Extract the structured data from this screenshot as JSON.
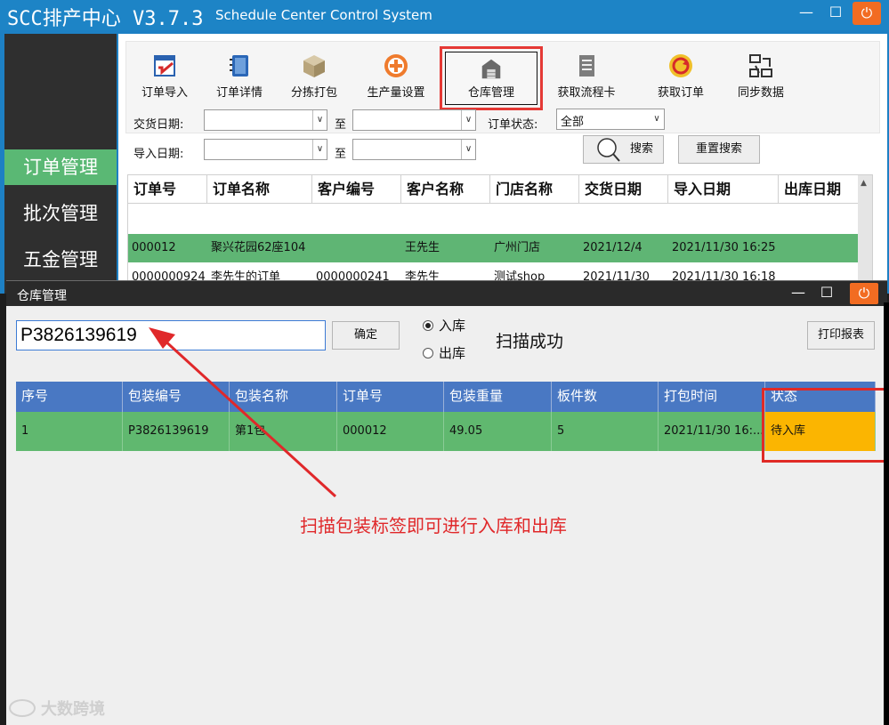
{
  "main": {
    "title": "SCC排产中心 V3.7.3",
    "subtitle": "Schedule Center Control System",
    "window_buttons": {
      "min": "—",
      "max": "☐",
      "close": "⏻"
    }
  },
  "nav": {
    "items": [
      {
        "label": "订单管理",
        "active": true
      },
      {
        "label": "批次管理",
        "active": false
      },
      {
        "label": "五金管理",
        "active": false
      }
    ]
  },
  "toolbar": {
    "items": [
      {
        "label": "订单导入",
        "icon": "order-import-icon"
      },
      {
        "label": "订单详情",
        "icon": "notebook-icon"
      },
      {
        "label": "分拣打包",
        "icon": "package-box-icon"
      },
      {
        "label": "生产量设置",
        "icon": "plus-circle-icon"
      },
      {
        "label": "仓库管理",
        "icon": "warehouse-icon"
      },
      {
        "label": "获取流程卡",
        "icon": "document-list-icon"
      },
      {
        "label": "获取订单",
        "icon": "refresh-circle-icon"
      },
      {
        "label": "同步数据",
        "icon": "sync-network-icon"
      }
    ]
  },
  "filters": {
    "delivery_date_label": "交货日期:",
    "import_date_label": "导入日期:",
    "to_label": "至",
    "order_status_label": "订单状态:",
    "order_status_value": "全部",
    "search_label": "搜索",
    "reset_label": "重置搜索"
  },
  "order_table": {
    "headers": [
      "订单号",
      "订单名称",
      "客户编号",
      "客户名称",
      "门店名称",
      "交货日期",
      "导入日期",
      "出库日期"
    ],
    "rows": [
      [
        "000012",
        "聚兴花园62座104",
        "",
        "王先生",
        "广州门店",
        "2021/12/4",
        "2021/11/30 16:25",
        ""
      ],
      [
        "0000000924",
        "李先生的订单",
        "0000000241",
        "李先生",
        "测试shop",
        "2021/11/30",
        "2021/11/30 16:18",
        ""
      ]
    ]
  },
  "warehouse": {
    "title": "仓库管理",
    "window_buttons": {
      "min": "—",
      "max": "☐",
      "close": "⏻"
    },
    "scan_value": "P3826139619",
    "confirm_label": "确定",
    "radio_in": "入库",
    "radio_out": "出库",
    "selected_mode": "入库",
    "scan_status": "扫描成功",
    "print_label": "打印报表",
    "headers": [
      "序号",
      "包装编号",
      "包装名称",
      "订单号",
      "包装重量",
      "板件数",
      "打包时间",
      "状态"
    ],
    "rows": [
      [
        "1",
        "P3826139619",
        "第1包",
        "000012",
        "49.05",
        "5",
        "2021/11/30 16:...",
        "待入库"
      ]
    ]
  },
  "annotation": {
    "text": "扫描包装标签即可进行入库和出库",
    "color": "#e0282a"
  },
  "watermark": {
    "text": "大数跨境"
  },
  "colors": {
    "title_bar": "#1d84c6",
    "nav_active": "#5ab874",
    "row_highlight": "#60b86f",
    "table_header": "#4978c3",
    "status_pending": "#fbb501",
    "close_button": "#f26c22",
    "highlight_box": "#e53935"
  }
}
